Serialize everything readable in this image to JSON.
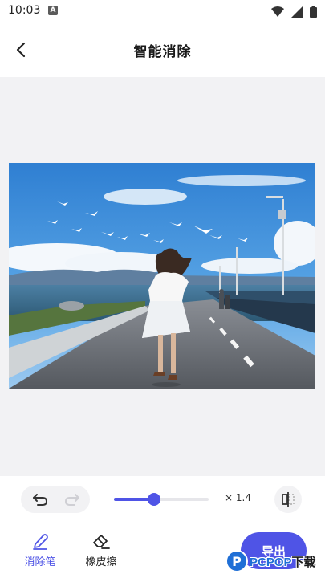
{
  "status_bar": {
    "time": "10:03",
    "notification_glyph": "A",
    "icons": [
      "wifi-icon",
      "signal-icon",
      "battery-icon"
    ]
  },
  "header": {
    "title": "智能消除",
    "back_icon": "chevron-left-icon"
  },
  "toolbar": {
    "undo_icon": "undo-icon",
    "redo_icon": "redo-icon",
    "redo_enabled": false,
    "brush_size_fraction": 0.42,
    "zoom_label": "× 1.4",
    "compare_icon": "compare-icon"
  },
  "bottom_bar": {
    "tabs": [
      {
        "label": "消除笔",
        "icon": "pen-icon",
        "selected": true
      },
      {
        "label": "橡皮擦",
        "icon": "eraser-icon",
        "selected": false
      }
    ],
    "export_label": "导出"
  },
  "watermark": {
    "mark": "P",
    "text_latin": "PCPOP",
    "text_cn": "下载"
  },
  "colors": {
    "accent": "#4f54e6",
    "canvas_bg": "#f2f2f4",
    "sky": "#3f8ad6",
    "sea": "#3e6e8f",
    "road": "#5f6368"
  }
}
